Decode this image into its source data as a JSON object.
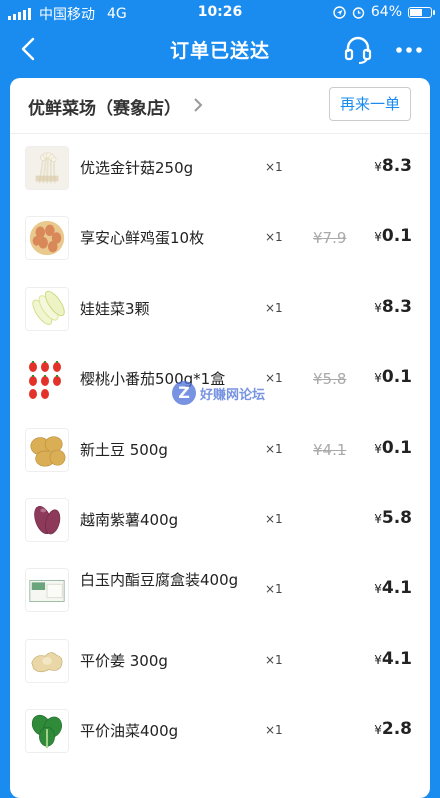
{
  "status_bar": {
    "carrier": "中国移动",
    "network": "4G",
    "time": "10:26",
    "battery": "64%",
    "battery_level": 0.64
  },
  "nav": {
    "title": "订单已送达",
    "back_icon": "back-arrow-icon",
    "service_icon": "customer-service-headset-icon",
    "more_icon": "more-dots-icon"
  },
  "shop": {
    "name": "优鲜菜场（赛象店）",
    "reorder_label": "再来一单"
  },
  "currency_symbol": "¥",
  "items": [
    {
      "name": "优选金针菇250g",
      "qty": "×1",
      "original_price": "",
      "price": "8.3",
      "image": "enoki-mushroom"
    },
    {
      "name": "享安心鲜鸡蛋10枚",
      "qty": "×1",
      "original_price": "7.9",
      "price": "0.1",
      "image": "eggs"
    },
    {
      "name": "娃娃菜3颗",
      "qty": "×1",
      "original_price": "",
      "price": "8.3",
      "image": "baby-cabbage"
    },
    {
      "name": "樱桃小番茄500g*1盒",
      "qty": "×1",
      "original_price": "5.8",
      "price": "0.1",
      "image": "cherry-tomatoes"
    },
    {
      "name": "新土豆 500g",
      "qty": "×1",
      "original_price": "4.1",
      "price": "0.1",
      "image": "potatoes"
    },
    {
      "name": "越南紫薯400g",
      "qty": "×1",
      "original_price": "",
      "price": "5.8",
      "image": "purple-sweet-potato"
    },
    {
      "name": "白玉内酯豆腐盒装400g",
      "qty": "×1",
      "original_price": "",
      "price": "4.1",
      "image": "tofu-box"
    },
    {
      "name": "平价姜 300g",
      "qty": "×1",
      "original_price": "",
      "price": "4.1",
      "image": "ginger"
    },
    {
      "name": "平价油菜400g",
      "qty": "×1",
      "original_price": "",
      "price": "2.8",
      "image": "bok-choy"
    }
  ],
  "watermark": {
    "mark": "Z",
    "text": "好赚网论坛"
  }
}
